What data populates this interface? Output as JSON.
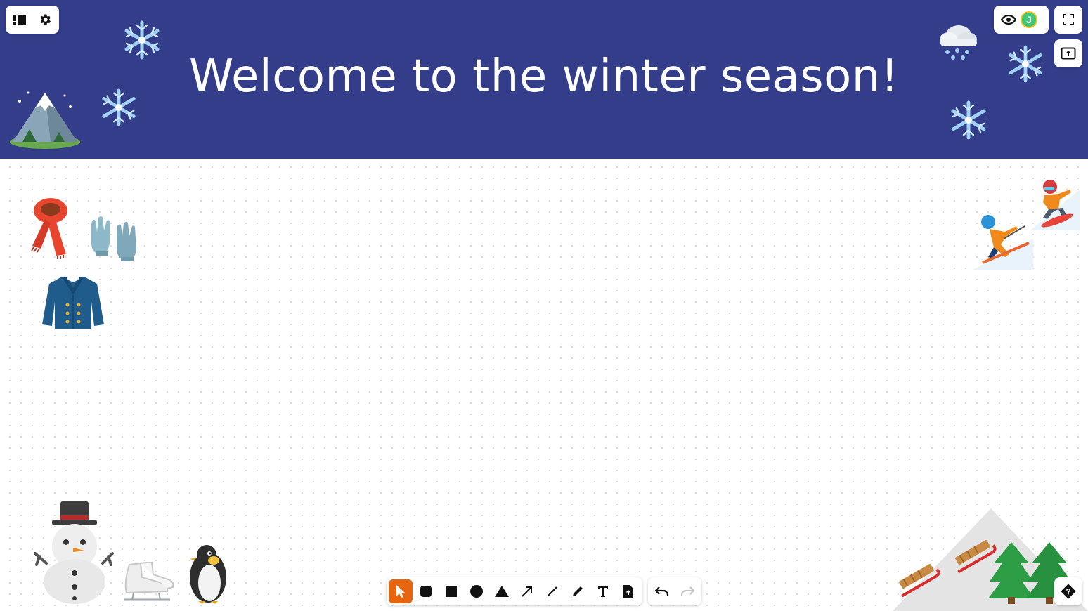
{
  "banner": {
    "title": "Welcome to the winter season!",
    "background": "#333d8a"
  },
  "user": {
    "initial": "J",
    "avatar_color": "#3ec97a"
  },
  "toolbar": {
    "active_tool": "select",
    "accent": "#e8650f",
    "tools": [
      "select-icon",
      "rounded-rect-icon",
      "rectangle-icon",
      "ellipse-icon",
      "triangle-icon",
      "arrow-icon",
      "line-icon",
      "pencil-icon",
      "text-icon",
      "upload-file-icon"
    ],
    "history": [
      "undo-icon",
      "redo-icon"
    ]
  },
  "stickers": [
    "snowflake",
    "mountain",
    "cloud-with-snow",
    "scarf",
    "gloves",
    "coat",
    "skier",
    "snowboarder",
    "snowman",
    "ice-skate",
    "penguin",
    "sled",
    "evergreen-tree"
  ]
}
